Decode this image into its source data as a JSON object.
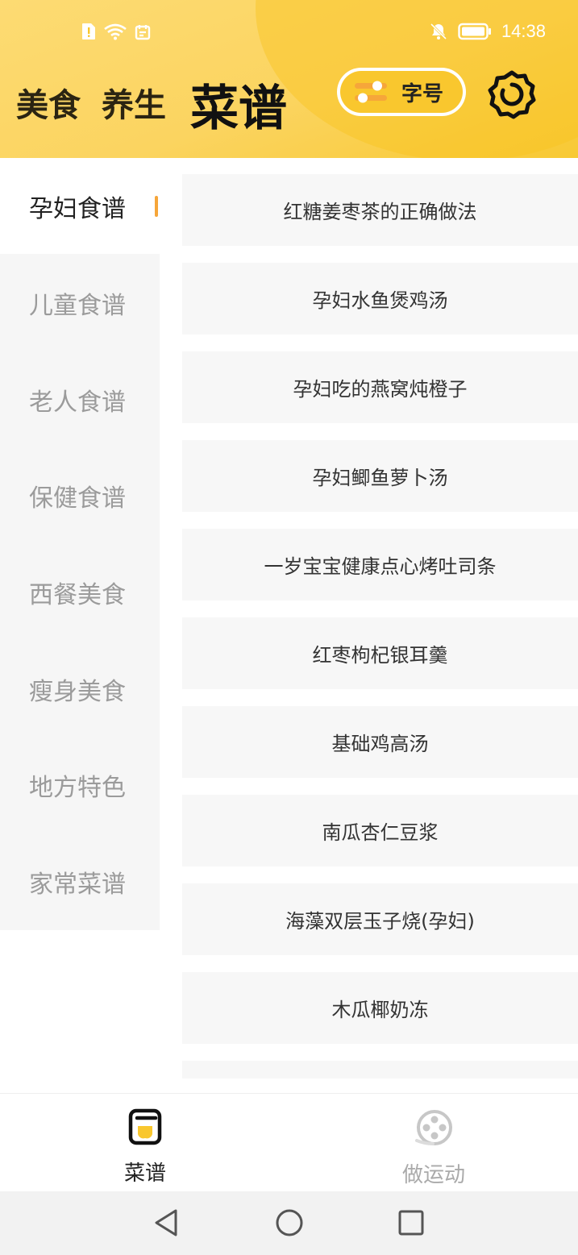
{
  "status_bar": {
    "time": "14:38"
  },
  "header": {
    "tabs": [
      "美食",
      "养生"
    ],
    "title": "菜谱",
    "font_button_label": "字号"
  },
  "sidebar": {
    "items": [
      {
        "label": "孕妇食谱",
        "active": true
      },
      {
        "label": "儿童食谱",
        "active": false
      },
      {
        "label": "老人食谱",
        "active": false
      },
      {
        "label": "保健食谱",
        "active": false
      },
      {
        "label": "西餐美食",
        "active": false
      },
      {
        "label": "瘦身美食",
        "active": false
      },
      {
        "label": "地方特色",
        "active": false
      },
      {
        "label": "家常菜谱",
        "active": false
      }
    ]
  },
  "recipes": [
    "红糖姜枣茶的正确做法",
    "孕妇水鱼煲鸡汤",
    "孕妇吃的燕窝炖橙子",
    "孕妇鲫鱼萝卜汤",
    "一岁宝宝健康点心烤吐司条",
    "红枣枸杞银耳羹",
    "基础鸡高汤",
    "南瓜杏仁豆浆",
    "海藻双层玉子烧(孕妇)",
    "木瓜椰奶冻",
    ""
  ],
  "bottom_nav": {
    "items": [
      {
        "label": "菜谱",
        "icon": "recipe-book-icon",
        "active": true
      },
      {
        "label": "做运动",
        "icon": "film-reel-icon",
        "active": false
      }
    ]
  },
  "colors": {
    "header_yellow": "#fbd460",
    "accent_orange": "#f6a63a",
    "button_yellow": "#f9c72e",
    "sidebar_bg": "#f6f6f6",
    "card_bg": "#f7f7f7"
  }
}
